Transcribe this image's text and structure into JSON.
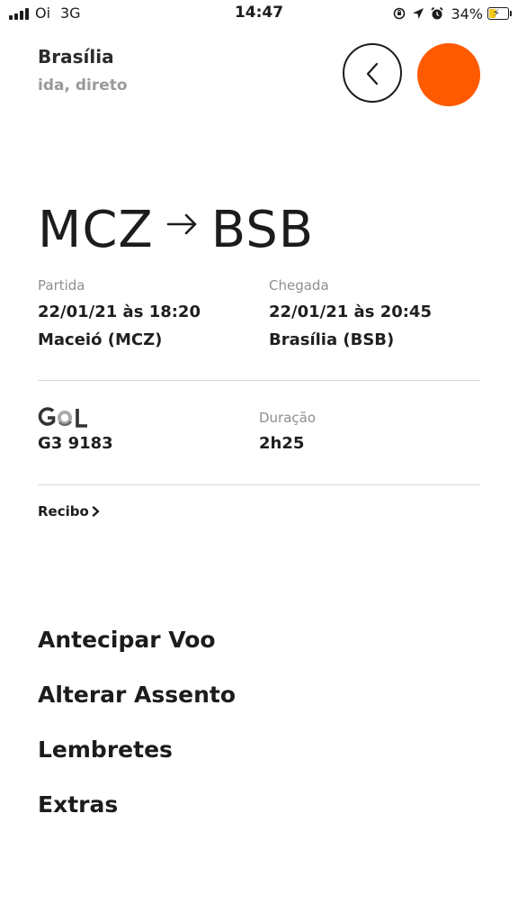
{
  "status_bar": {
    "carrier": "Oi",
    "network": "3G",
    "time": "14:47",
    "battery_percent": "34%",
    "battery_level": 0.34,
    "battery_color": "#f2c81a",
    "icons": [
      "signal-bars-icon",
      "orientation-lock-icon",
      "location-arrow-icon",
      "alarm-icon",
      "battery-charging-icon"
    ]
  },
  "header": {
    "title": "Brasília",
    "subtitle": "ida, direto",
    "back_icon": "chevron-left-icon",
    "accent_color": "#ff5a00"
  },
  "route": {
    "origin": "MCZ",
    "destination": "BSB",
    "arrow_icon": "arrow-right-icon"
  },
  "departure": {
    "label": "Partida",
    "datetime": "22/01/21 às 18:20",
    "city": "Maceió (MCZ)"
  },
  "arrival": {
    "label": "Chegada",
    "datetime": "22/01/21 às 20:45",
    "city": "Brasília (BSB)"
  },
  "flight": {
    "airline_logo_text": "GOL",
    "number": "G3 9183",
    "duration_label": "Duração",
    "duration": "2h25"
  },
  "receipt": {
    "label": "Recibo",
    "icon": "chevron-right-icon"
  },
  "actions": [
    {
      "label": "Antecipar Voo"
    },
    {
      "label": "Alterar Assento"
    },
    {
      "label": "Lembretes"
    },
    {
      "label": "Extras"
    }
  ]
}
